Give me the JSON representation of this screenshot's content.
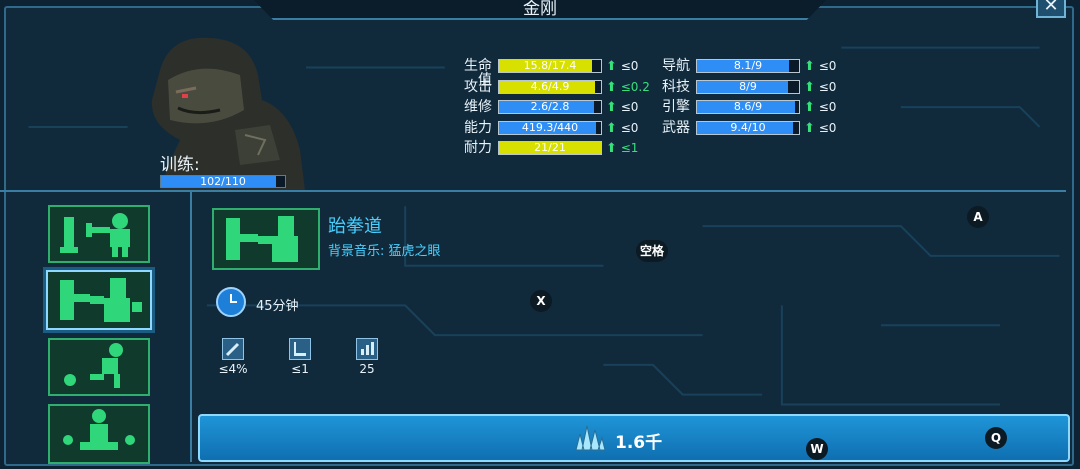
{
  "window": {
    "title": "金刚",
    "close_symbol": "✕"
  },
  "character": {
    "training_label": "训练:",
    "training_progress_text": "102/110",
    "training_progress": 0.927
  },
  "stats_left": [
    {
      "name": "生命值",
      "value": "15.8/17.4",
      "fraction": 0.91,
      "color": "#d8e000",
      "mod": "≤0"
    },
    {
      "name": "攻击",
      "value": "4.6/4.9",
      "fraction": 0.94,
      "color": "#d8e000",
      "mod": "≤0.2",
      "mod_color": "#37e07a"
    },
    {
      "name": "维修",
      "value": "2.6/2.8",
      "fraction": 0.93,
      "color": "#2e8ef5",
      "mod": "≤0"
    },
    {
      "name": "能力",
      "value": "419.3/440",
      "fraction": 0.95,
      "color": "#2e8ef5",
      "mod": "≤0"
    },
    {
      "name": "耐力",
      "value": "21/21",
      "fraction": 1.0,
      "color": "#d8e000",
      "mod": "≤1",
      "mod_color": "#37e07a"
    }
  ],
  "stats_right": [
    {
      "name": "导航",
      "value": "8.1/9",
      "fraction": 0.9,
      "color": "#2e8ef5",
      "mod": "≤0"
    },
    {
      "name": "科技",
      "value": "8/9",
      "fraction": 0.89,
      "color": "#2e8ef5",
      "mod": "≤0"
    },
    {
      "name": "引擎",
      "value": "8.6/9",
      "fraction": 0.96,
      "color": "#2e8ef5",
      "mod": "≤0"
    },
    {
      "name": "武器",
      "value": "9.4/10",
      "fraction": 0.94,
      "color": "#2e8ef5",
      "mod": "≤0"
    }
  ],
  "training_list": [
    {
      "name": "weights-training"
    },
    {
      "name": "boxing-training",
      "selected": true
    },
    {
      "name": "running-training"
    },
    {
      "name": "meditation-training"
    }
  ],
  "detail": {
    "title": "跆拳道",
    "music": "背景音乐: 猛虎之眼",
    "duration": "45分钟",
    "effects": [
      {
        "icon": "sword-icon",
        "value": "≤4%"
      },
      {
        "icon": "boot-icon",
        "value": "≤1"
      },
      {
        "icon": "bar-chart-icon",
        "value": "25"
      }
    ]
  },
  "key_hints": {
    "a": "A",
    "space": "空格",
    "x": "X",
    "w": "W",
    "q": "Q"
  },
  "start_button": {
    "cost": "1.6千",
    "icon": "crystal-icon"
  },
  "colors": {
    "accent": "#2e8ef5",
    "yellow_bar": "#d8e000",
    "green": "#37e07a",
    "panel": "#102a3c",
    "border": "#3a7fa3"
  }
}
